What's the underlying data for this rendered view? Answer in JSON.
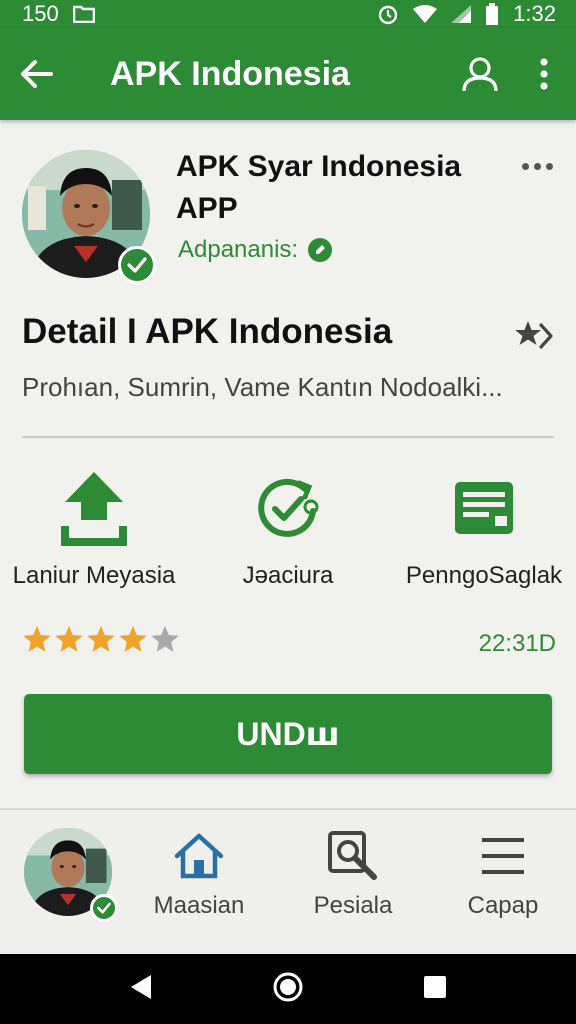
{
  "status_bar": {
    "left_number": "150",
    "time": "1:32"
  },
  "app_bar": {
    "title": "APK Indonesia",
    "icons": [
      "back-arrow-icon",
      "account-icon",
      "more-vert-icon"
    ]
  },
  "header": {
    "app_name": "APK Syar Indonesia APP",
    "developer": "Adpananis:",
    "more_icon": "more-horiz-icon"
  },
  "detail": {
    "title": "Detail I APK Indonesia",
    "description": "Prohıan,  Sumrin,  Vame Kantın Nodoalki..."
  },
  "features": [
    {
      "label": "Laniur Meyasia",
      "icon": "upload-icon"
    },
    {
      "label": "Jəaciura",
      "icon": "sync-check-icon"
    },
    {
      "label": "PenngoSaglak",
      "icon": "storage-card-icon"
    }
  ],
  "rating": {
    "stars": 4,
    "max": 5,
    "size_text": "22:31D"
  },
  "install_button": {
    "label": "UNDꟺ"
  },
  "bottom_nav": {
    "items": [
      {
        "label": "Maasian",
        "icon": "home-icon"
      },
      {
        "label": "Pesiala",
        "icon": "search-icon"
      },
      {
        "label": "Capap",
        "icon": "menu-icon"
      }
    ]
  },
  "colors": {
    "primary": "#2e8b35",
    "background": "#f1f1ee",
    "star": "#f0a328"
  }
}
